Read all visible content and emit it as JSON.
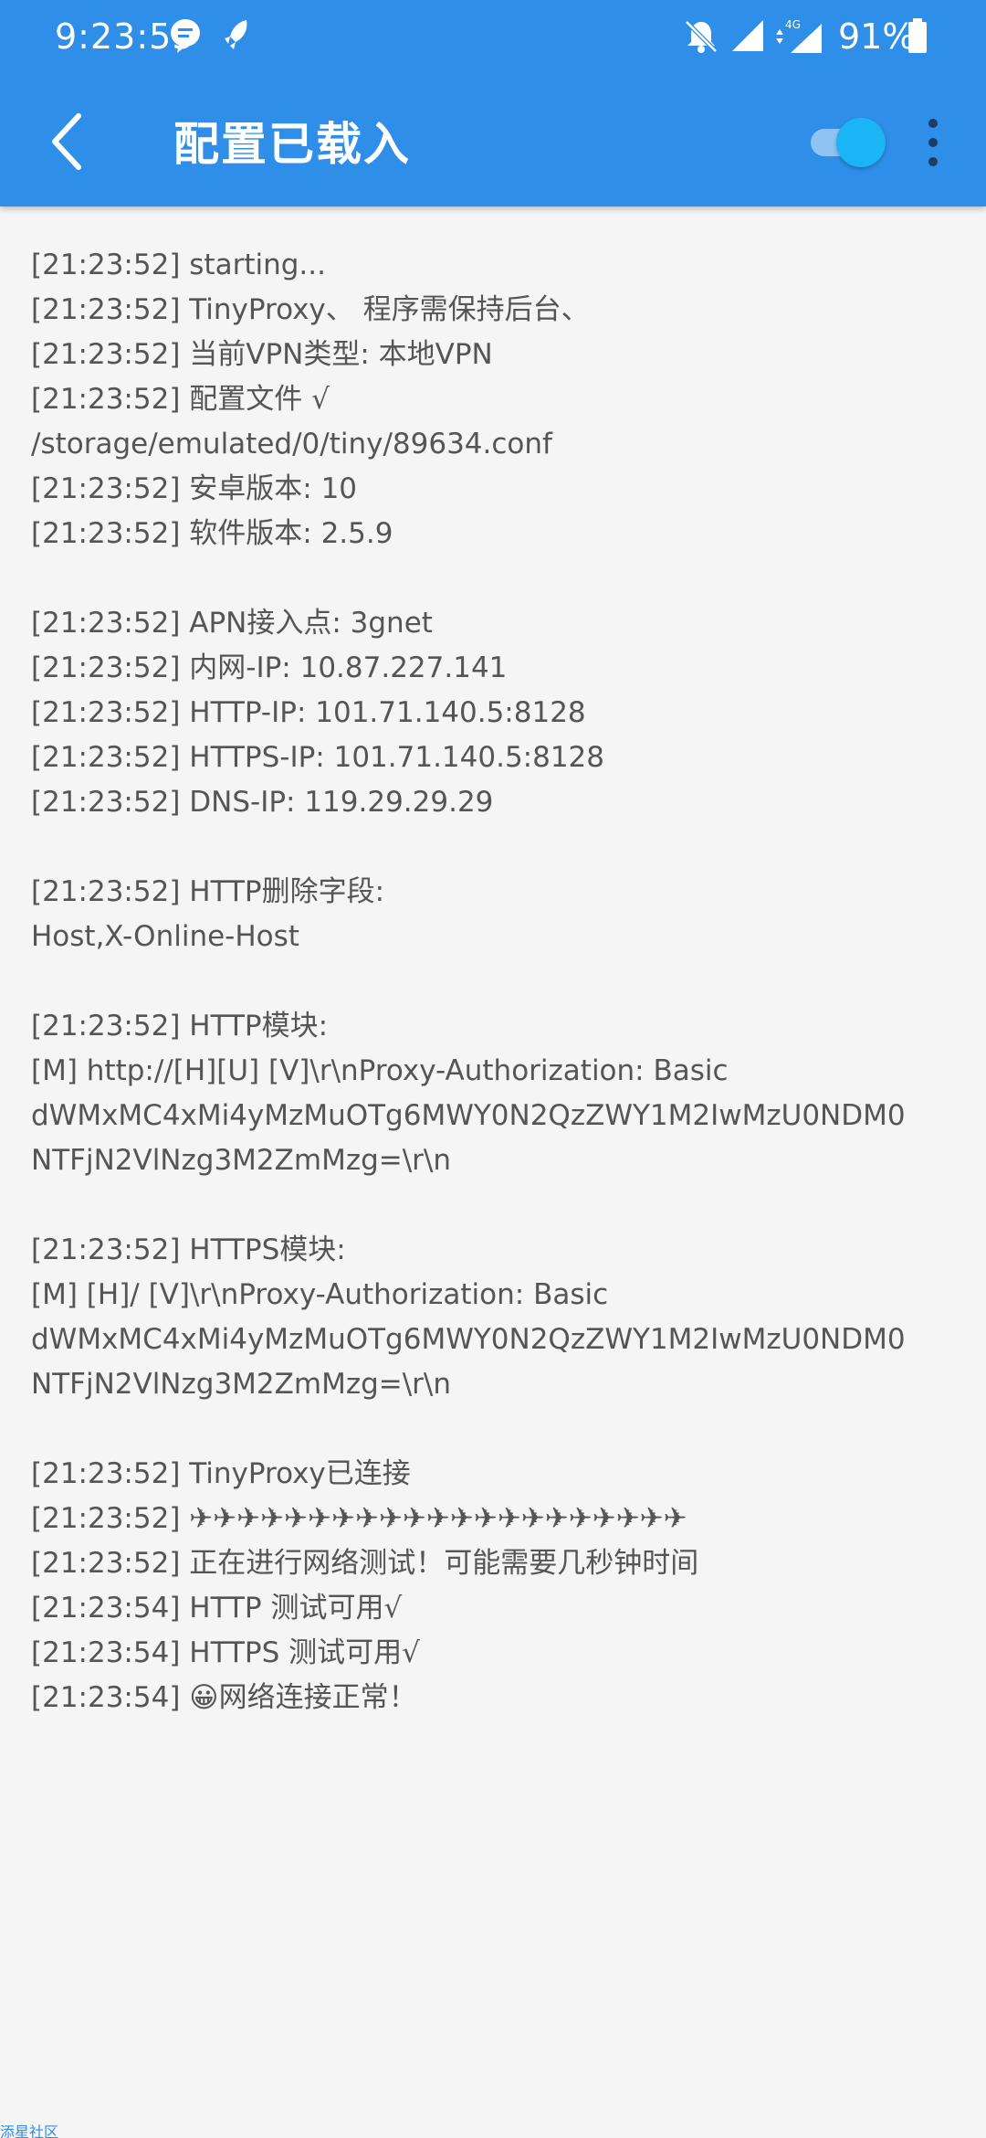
{
  "status_bar": {
    "time": "9:23:55",
    "battery": "91%",
    "icons": [
      "chat-bubble-icon",
      "rocket-icon",
      "bell-off-icon",
      "signal-icon",
      "4g-signal-icon",
      "battery-icon"
    ]
  },
  "toolbar": {
    "title": "配置已载入",
    "back_icon": "chevron-left-icon",
    "toggle_on": true,
    "more_icon": "more-vertical-icon"
  },
  "colors": {
    "appbar": "#2f8ee8",
    "toggle_thumb": "#1bb4f5",
    "log_text": "#555555",
    "background": "#f5f5f5"
  },
  "log_lines": [
    "[21:23:52] starting...",
    "[21:23:52] TinyProxy、 程序需保持后台、",
    "[21:23:52] 当前VPN类型: 本地VPN",
    "[21:23:52] 配置文件 √",
    "/storage/emulated/0/tiny/89634.conf",
    "[21:23:52] 安卓版本: 10",
    "[21:23:52] 软件版本: 2.5.9",
    "",
    "[21:23:52] APN接入点: 3gnet",
    "[21:23:52] 内网-IP: 10.87.227.141",
    "[21:23:52] HTTP-IP: 101.71.140.5:8128",
    "[21:23:52] HTTPS-IP: 101.71.140.5:8128",
    "[21:23:52] DNS-IP: 119.29.29.29",
    "",
    "[21:23:52] HTTP删除字段:",
    "Host,X-Online-Host",
    "",
    "[21:23:52] HTTP模块:",
    "[M] http://[H][U] [V]\\r\\nProxy-Authorization: Basic",
    "dWMxMC4xMi4yMzMuOTg6MWY0N2QzZWY1M2IwMzU0NDM0",
    "NTFjN2VlNzg3M2ZmMzg=\\r\\n",
    "",
    "[21:23:52] HTTPS模块:",
    "[M] [H]/ [V]\\r\\nProxy-Authorization: Basic",
    "dWMxMC4xMi4yMzMuOTg6MWY0N2QzZWY1M2IwMzU0NDM0",
    "NTFjN2VlNzg3M2ZmMzg=\\r\\n",
    "",
    "[21:23:52] TinyProxy已连接",
    "[21:23:52] ✈✈✈✈✈✈✈✈✈✈✈✈✈✈✈✈✈✈✈✈✈",
    "[21:23:52] 正在进行网络测试！可能需要几秒钟时间",
    "[21:23:54] HTTP 测试可用√",
    "[21:23:54] HTTPS 测试可用√",
    "[21:23:54] 😀网络连接正常！"
  ],
  "watermark": "添星社区"
}
